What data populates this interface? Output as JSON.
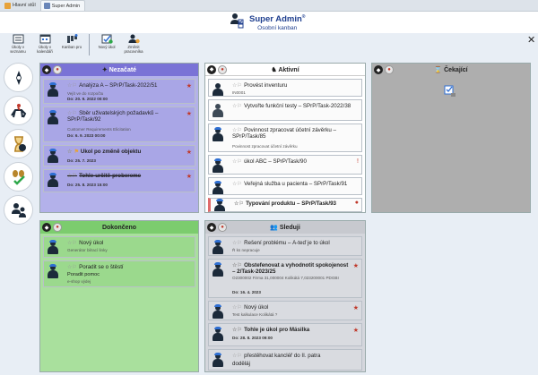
{
  "tabs": [
    {
      "label": "Hlavní stůl",
      "icon": "home-icon"
    },
    {
      "label": "Super Admin",
      "icon": "user-icon"
    }
  ],
  "header": {
    "title": "Super Admin",
    "subtitle": "Osobní kanban",
    "info_mark": "®"
  },
  "toolbar": [
    {
      "label": "Úkoly v seznamu",
      "icon": "list-icon"
    },
    {
      "label": "Úkoly v kalendáři",
      "icon": "calendar-icon"
    },
    {
      "label": "Kanban pro",
      "icon": "kanban-icon"
    },
    {
      "label": "Nový úkol",
      "icon": "new-task-icon"
    },
    {
      "label": "Změnit pracovníka",
      "icon": "change-worker-icon"
    }
  ],
  "left_buttons": [
    {
      "name": "all-tasks-button",
      "icon": "compass-icon"
    },
    {
      "name": "running-button",
      "icon": "rider-icon"
    },
    {
      "name": "waiting-button",
      "icon": "hourglass-icon"
    },
    {
      "name": "done-button",
      "icon": "check-icon"
    },
    {
      "name": "delegated-button",
      "icon": "people-icon"
    }
  ],
  "columns": {
    "nezacate": {
      "title": "Nezačaté",
      "cards": [
        {
          "title": "Analýza A – SPrP/Task-2022/51",
          "sub": "Vejít ve do rozpočtu",
          "date": "Do: 20. 9. 2022 00:00"
        },
        {
          "title": "Sběr uživatelských požadavků – SPrP/Task/92",
          "sub": "Customer Requirements Elicitation",
          "date": "Do: 6. 9. 2023 00:00"
        },
        {
          "title": "Úkol po změně objektu",
          "sub": "",
          "date": "Do: 25. 7. 2023"
        },
        {
          "title": "Tohle-určitě-probereme",
          "sub": "",
          "date": "Do: 25. 8. 2023 15:00"
        }
      ]
    },
    "aktivni": {
      "title": "Aktivní",
      "cards": [
        {
          "title": "Provést inventuru",
          "sub": "IN0001",
          "date": ""
        },
        {
          "title": "Vytvořte funkční testy – SPrP/Task-2022/38",
          "sub": "",
          "date": ""
        },
        {
          "title": "Povinnost zpracovat účetní závěrku – SPrP/Task/85",
          "sub": "Povinnost zpracovat účetní závěrku",
          "date": ""
        },
        {
          "title": "úkol ABC – SPrP/Task/90",
          "sub": "",
          "date": ""
        },
        {
          "title": "Veřejná služba u pacienta – SPrP/Task/91",
          "sub": "",
          "date": ""
        },
        {
          "title": "Typování produktu – SPrP/Task/93",
          "sub": "",
          "date": ""
        }
      ]
    },
    "cekajici": {
      "title": "Čekající",
      "cards": []
    },
    "dokonceno": {
      "title": "Dokončeno",
      "cards": [
        {
          "title": "Nový úkol",
          "sub": "Generátor bilrací linky",
          "date": ""
        },
        {
          "title": "Poradit se o štěstí",
          "sub": "Poradit pomoc",
          "date": "e-shop výdej"
        }
      ]
    },
    "sledujici": {
      "title": "Sleduji",
      "cards": [
        {
          "title": "Řešení problému – Á-teď je to úkol",
          "sub": "Ř ks nepracuje",
          "date": ""
        },
        {
          "title": "Obstefenovat a vyhodnotit spokojenost – 2/Task-2023/25",
          "sub": "O2300002 Firma 31,000004 Kolikátá 7,023200001 PDGBI",
          "date": "Do: 16. 4. 2023"
        },
        {
          "title": "Nový úkol",
          "sub": "Test kalkulace Kolikátá ?",
          "date": ""
        },
        {
          "title": "Tohle je úkol pro Másilka",
          "sub": "",
          "date": "Do: 28. 8. 2023 09:00"
        },
        {
          "title": "přestěhovat kancléř do II. patra",
          "sub": "doděláj",
          "date": ""
        }
      ]
    }
  },
  "colors": {
    "nezacate_header": "#7a73d6",
    "nezacate_body": "#b3b1ea",
    "aktivni_body": "#ffffff",
    "cekajici_body": "#aeaeae",
    "dokonceno_header": "#7ccc6e",
    "dokonceno_body": "#a9e09d",
    "sledujici_body": "#d4d6dc"
  }
}
